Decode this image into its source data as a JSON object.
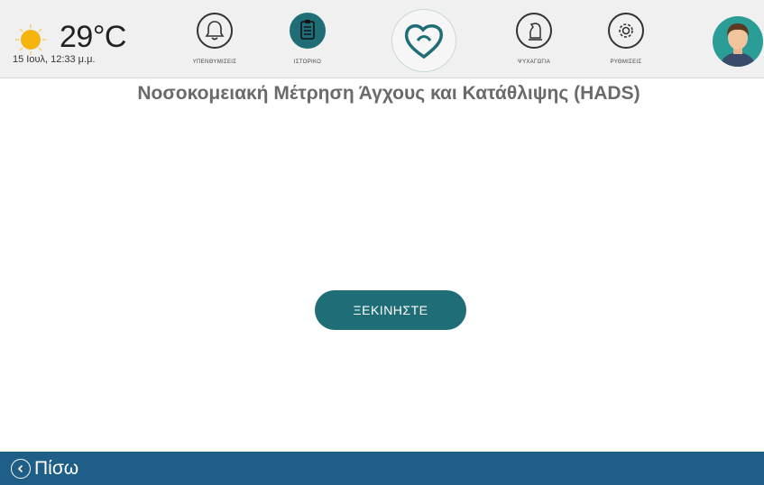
{
  "header": {
    "temperature": "29°C",
    "datetime": "15 Ιουλ, 12:33 μ.μ.",
    "weather_icon": "sun-icon"
  },
  "nav": {
    "reminders": "ΥΠΕΝΘΥΜΙΣΕΙΣ",
    "history": "ΙΣΤΟΡΙΚΟ",
    "entertainment": "ΨΥΧΑΓΩΓΙΑ",
    "settings": "ΡΥΘΜΙΣΕΙΣ"
  },
  "main": {
    "title": "Νοσοκομειακή Μέτρηση Άγχους και Κατάθλιψης (HADS)",
    "start_label": "ΞΕΚΙΝΗΣΤΕ"
  },
  "footer": {
    "back_label": "Πίσω"
  },
  "colors": {
    "accent": "#1f6e77",
    "footer": "#1f5e86",
    "sun": "#f6b40e",
    "title": "#6a6a6a"
  }
}
